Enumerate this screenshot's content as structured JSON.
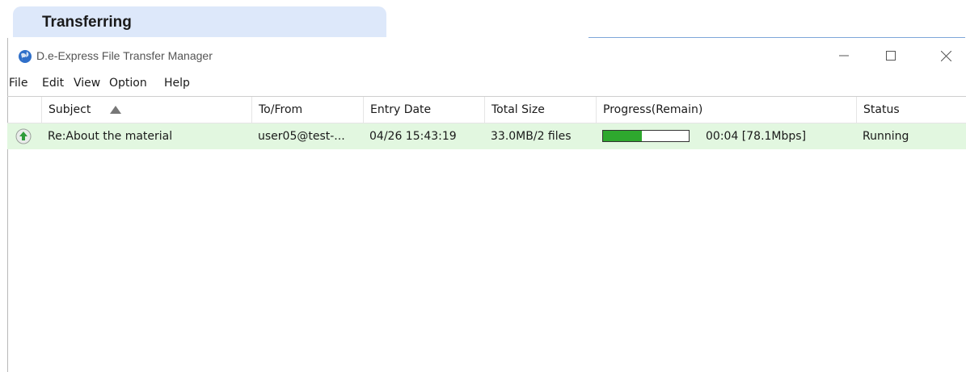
{
  "caption": "Transferring",
  "window": {
    "title": "D.e-Express File Transfer Manager",
    "icon": "globe-icon",
    "controls": {
      "minimize": "minimize-icon",
      "maximize": "maximize-icon",
      "close": "close-icon"
    }
  },
  "menu": [
    "File",
    "Edit",
    "View",
    "Option",
    "Help"
  ],
  "columns": {
    "subject": "Subject",
    "to_from": "To/From",
    "entry_date": "Entry Date",
    "total_size": "Total Size",
    "progress": "Progress(Remain)",
    "status": "Status",
    "sort_indicator": "sort-ascending-icon"
  },
  "rows": [
    {
      "icon": "upload-arrow-icon",
      "subject": "Re:About the material",
      "to_from": "user05@test-...",
      "entry_date": "04/26 15:43:19",
      "total_size": "33.0MB/2 files",
      "progress_fraction": 0.45,
      "remain": "00:04 [78.1Mbps]",
      "status": "Running"
    }
  ],
  "colors": {
    "caption_bg": "#dde8fa",
    "row_highlight": "#e2f7e0",
    "progress_fill": "#2ea82e"
  }
}
